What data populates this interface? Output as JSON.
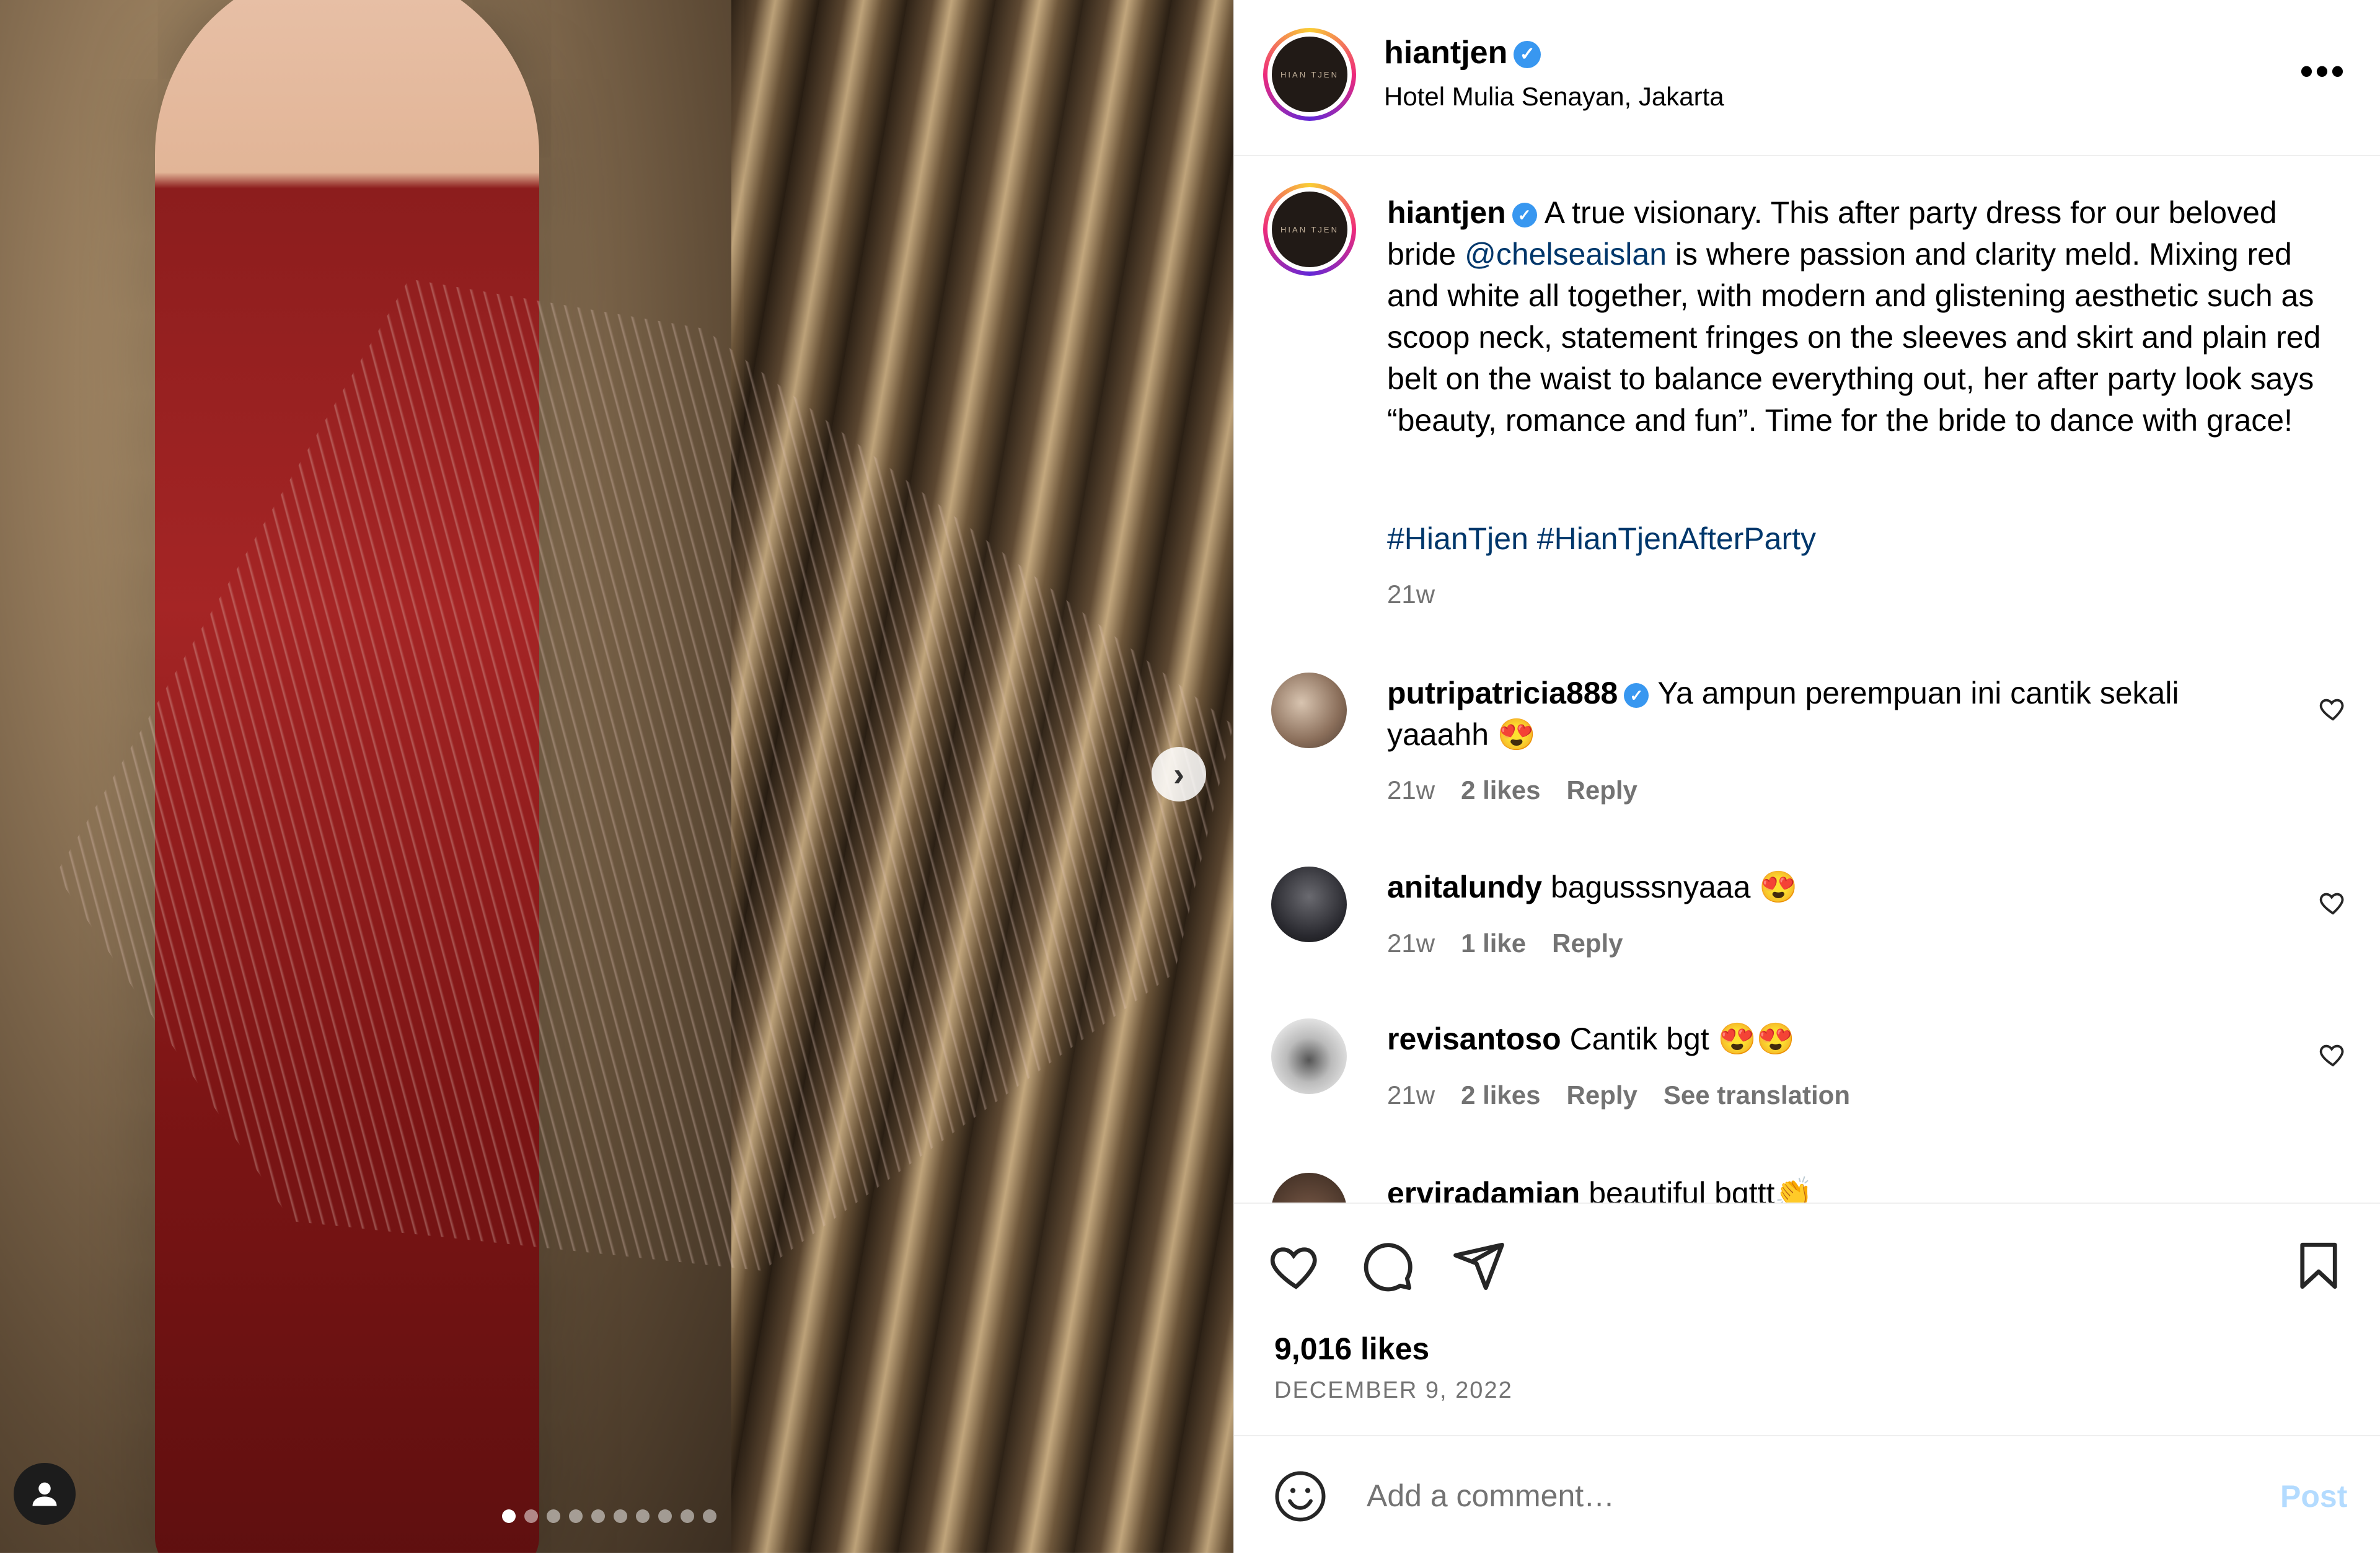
{
  "post": {
    "username": "hiantjen",
    "verified_mark": "✓",
    "location": "Hotel Mulia Senayan, Jakarta",
    "avatar_text": "HIAN TJEN",
    "more_label": "•••"
  },
  "caption": {
    "username": "hiantjen",
    "text_before_mention": "A true visionary. This after party dress for our beloved bride ",
    "mention": "@chelseaislan",
    "text_after_mention": " is where passion and clarity meld. Mixing red and white all together, with modern and glistening aesthetic such as scoop neck, statement fringes on the sleeves and skirt and plain red belt on the waist to balance everything out, her after party look says “beauty, romance and fun”. Time for the bride to dance with grace!",
    "hashtags": "#HianTjen #HianTjenAfterParty",
    "time": "21w"
  },
  "comments": [
    {
      "username": "putripatricia888",
      "verified": true,
      "text": "Ya ampun perempuan ini cantik sekali yaaahh 😍",
      "time": "21w",
      "likes": "2 likes",
      "reply": "Reply",
      "extra": ""
    },
    {
      "username": "anitalundy",
      "verified": false,
      "text": "bagusssnyaaa 😍",
      "time": "21w",
      "likes": "1 like",
      "reply": "Reply",
      "extra": ""
    },
    {
      "username": "revisantoso",
      "verified": false,
      "text": "Cantik bgt 😍😍",
      "time": "21w",
      "likes": "2 likes",
      "reply": "Reply",
      "extra": "See translation"
    },
    {
      "username": "erviradamian",
      "verified": false,
      "text": "beautiful bgttt👏",
      "time": "",
      "likes": "",
      "reply": "",
      "extra": ""
    }
  ],
  "actions": {
    "likes": "9,016 likes",
    "date": "DECEMBER 9, 2022"
  },
  "composer": {
    "placeholder": "Add a comment…",
    "post_label": "Post"
  },
  "carousel": {
    "next_glyph": "›",
    "slide_count": 10,
    "active_index": 0
  },
  "icons": [
    "heart-icon",
    "comment-icon",
    "share-icon",
    "bookmark-icon",
    "emoji-icon",
    "user-tag-icon",
    "verified-icon",
    "more-icon",
    "chevron-right-icon"
  ],
  "colors": {
    "link": "#00376b",
    "verified": "#3897f0",
    "muted": "#737373",
    "post_disabled": "#b3dbff"
  }
}
